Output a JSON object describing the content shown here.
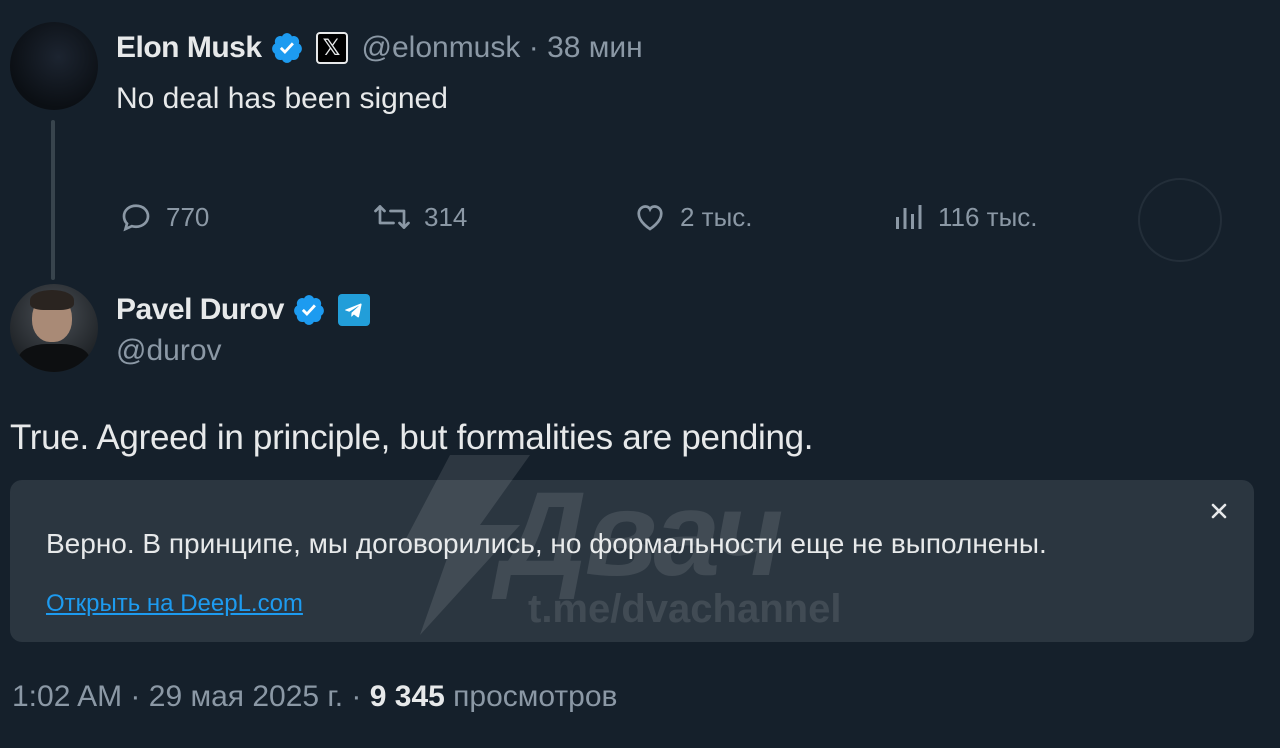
{
  "tweet_musk": {
    "name": "Elon Musk",
    "handle": "@elonmusk",
    "separator": "·",
    "time": "38 мин",
    "text": "No deal has been signed",
    "stats": {
      "replies": "770",
      "retweets": "314",
      "likes": "2 тыс.",
      "views": "116 тыс."
    },
    "icons": [
      "verified-badge-icon",
      "x-logo-icon",
      "reply-icon",
      "retweet-icon",
      "like-icon",
      "views-icon"
    ]
  },
  "tweet_durov": {
    "name": "Pavel Durov",
    "handle": "@durov",
    "text": "True. Agreed in principle, but formalities are pending.",
    "icons": [
      "verified-badge-icon",
      "telegram-logo-icon"
    ]
  },
  "translation": {
    "text": "Верно. В принципе, мы договорились, но формальности еще не выполнены.",
    "link": "Открыть на DeepL.com",
    "close_icon": "close-icon"
  },
  "footer": {
    "time": "1:02 AM",
    "sep1": "·",
    "date": "29 мая 2025 г.",
    "sep2": "·",
    "views_count": "9 345",
    "views_label": "просмотров"
  },
  "watermark": {
    "title": "Двач",
    "url": "t.me/dvachannel"
  },
  "colors": {
    "background": "#15202b",
    "text_primary": "#e7e9ea",
    "text_secondary": "#8b98a5",
    "accent_blue": "#1d9bf0",
    "translate_box": "#2b3640"
  }
}
